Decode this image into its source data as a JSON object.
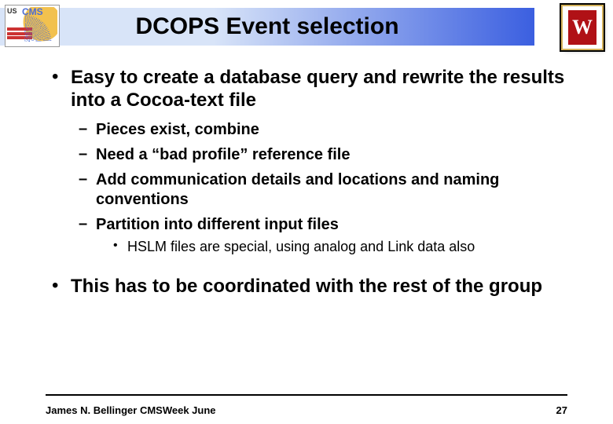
{
  "title": "DCOPS Event selection",
  "logo_left": {
    "us": "US",
    "cms": "CMS"
  },
  "logo_right": {
    "letter": "W"
  },
  "bullets": {
    "b1": "Easy to create a database query and rewrite the results into a Cocoa-text file",
    "b1_sub": {
      "s1": "Pieces exist, combine",
      "s2": "Need a “bad profile” reference file",
      "s3": "Add communication details and locations and naming conventions",
      "s4": "Partition into different input files",
      "s4_sub": {
        "t1": "HSLM files are special, using analog and Link data also"
      }
    },
    "b2": "This has to be coordinated with the rest of the group"
  },
  "footer": {
    "author": "James N. Bellinger CMSWeek June",
    "page": "27"
  }
}
